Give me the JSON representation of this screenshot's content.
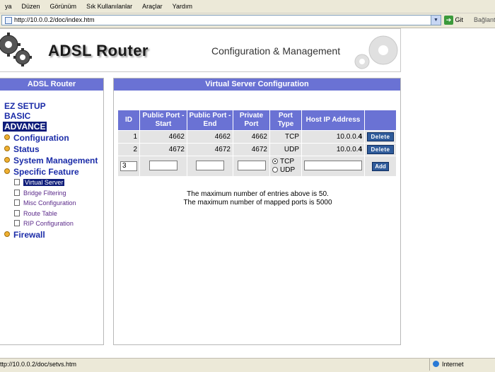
{
  "browser": {
    "menu": [
      "ya",
      "Düzen",
      "Görünüm",
      "Sık Kullanılanlar",
      "Araçlar",
      "Yardım"
    ],
    "address": "http://10.0.0.2/doc/index.htm",
    "go_label": "Git",
    "links_label": "Bağlantı",
    "status_url": "ttp://10.0.0.2/doc/setvs.htm",
    "status_zone": "Internet"
  },
  "header": {
    "brand": "ADSL Router",
    "subtitle": "Configuration & Management"
  },
  "sidebar": {
    "title": "ADSL Router",
    "top_links": [
      "EZ SETUP",
      "BASIC",
      "ADVANCE"
    ],
    "folders": [
      "Configuration",
      "Status",
      "System Management",
      "Specific Feature"
    ],
    "sub_items": [
      "Virtual Server",
      "Bridge Filtering",
      "Misc Configuration",
      "Route Table",
      "RIP Configuration"
    ],
    "last_folder": "Firewall"
  },
  "main": {
    "title": "Virtual Server Configuration",
    "table": {
      "headers": [
        "ID",
        "Public Port - Start",
        "Public Port - End",
        "Private Port",
        "Port Type",
        "Host IP Address",
        ""
      ],
      "rows": [
        {
          "id": "1",
          "start": "4662",
          "end": "4662",
          "private": "4662",
          "type": "TCP",
          "host_prefix": "10.0.0.",
          "host_last": "4",
          "action": "Delete"
        },
        {
          "id": "2",
          "start": "4672",
          "end": "4672",
          "private": "4672",
          "type": "UDP",
          "host_prefix": "10.0.0.",
          "host_last": "4",
          "action": "Delete"
        }
      ],
      "input_row": {
        "id_value": "3",
        "start_value": "",
        "end_value": "",
        "private_value": "",
        "radio_tcp": "TCP",
        "radio_udp": "UDP",
        "selected": "TCP",
        "host_value": "",
        "add_label": "Add"
      }
    },
    "notes": [
      "The maximum number of entries above is 50.",
      "The maximum number of mapped ports is 5000"
    ]
  },
  "colors": {
    "accent": "#6a72d4",
    "nav_text": "#1b2ca8",
    "selected_bg": "#0e1c7a",
    "button": "#2f5b9a"
  }
}
